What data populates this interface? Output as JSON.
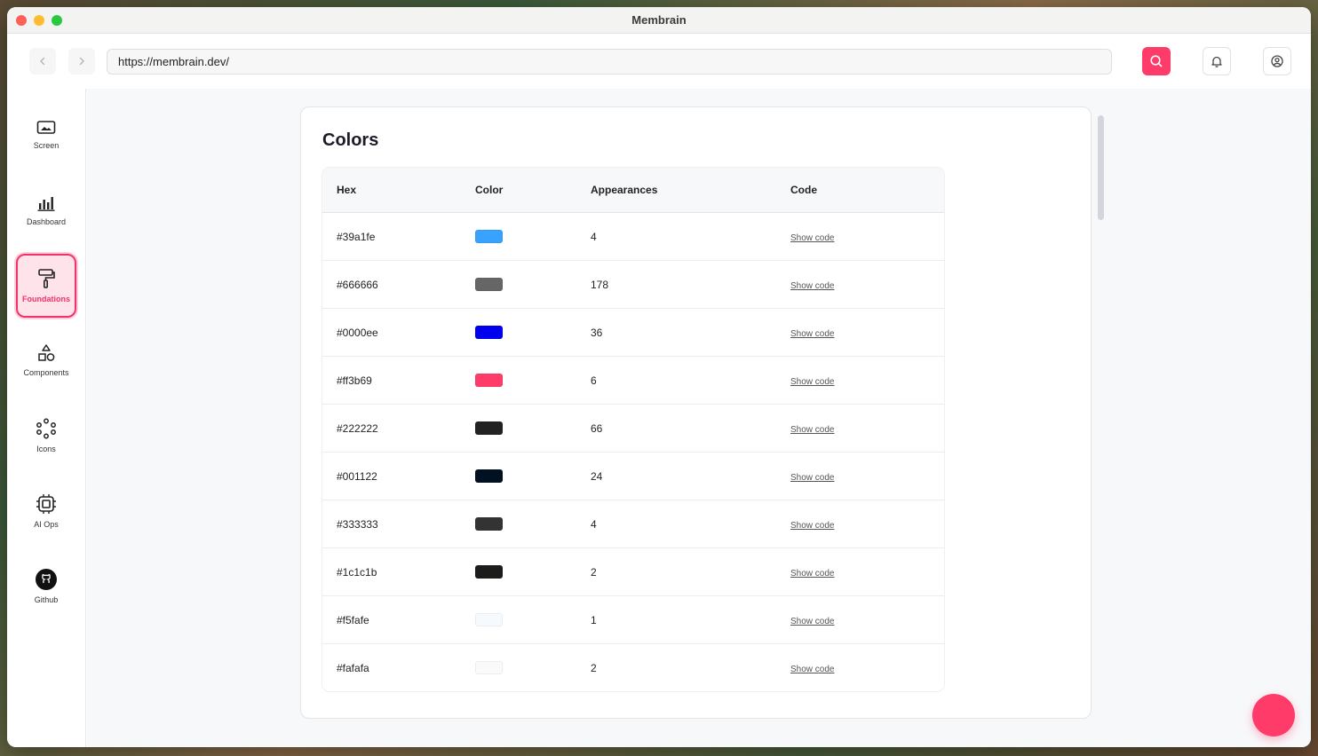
{
  "window": {
    "title": "Membrain"
  },
  "toolbar": {
    "url": "https://membrain.dev/",
    "back_icon": "chevron-left-icon",
    "forward_icon": "chevron-right-icon",
    "accent_color": "#ff3b69"
  },
  "sidebar": {
    "items": [
      {
        "label": "Screen",
        "icon": "screen-icon",
        "active": false
      },
      {
        "label": "Dashboard",
        "icon": "bar-chart-icon",
        "active": false
      },
      {
        "label": "Foundations",
        "icon": "paint-roller-icon",
        "active": true
      },
      {
        "label": "Components",
        "icon": "shapes-icon",
        "active": false
      },
      {
        "label": "Icons",
        "icon": "icons-grid-icon",
        "active": false
      },
      {
        "label": "AI Ops",
        "icon": "chip-icon",
        "active": false
      },
      {
        "label": "Github",
        "icon": "github-icon",
        "active": false
      }
    ]
  },
  "main": {
    "title": "Colors",
    "table": {
      "headers": [
        "Hex",
        "Color",
        "Appearances",
        "Code"
      ],
      "rows": [
        {
          "hex": "#39a1fe",
          "appearances": "4",
          "code": "Show code"
        },
        {
          "hex": "#666666",
          "appearances": "178",
          "code": "Show code"
        },
        {
          "hex": "#0000ee",
          "appearances": "36",
          "code": "Show code"
        },
        {
          "hex": "#ff3b69",
          "appearances": "6",
          "code": "Show code"
        },
        {
          "hex": "#222222",
          "appearances": "66",
          "code": "Show code"
        },
        {
          "hex": "#001122",
          "appearances": "24",
          "code": "Show code"
        },
        {
          "hex": "#333333",
          "appearances": "4",
          "code": "Show code"
        },
        {
          "hex": "#1c1c1b",
          "appearances": "2",
          "code": "Show code"
        },
        {
          "hex": "#f5fafe",
          "appearances": "1",
          "code": "Show code"
        },
        {
          "hex": "#fafafa",
          "appearances": "2",
          "code": "Show code"
        }
      ]
    }
  }
}
